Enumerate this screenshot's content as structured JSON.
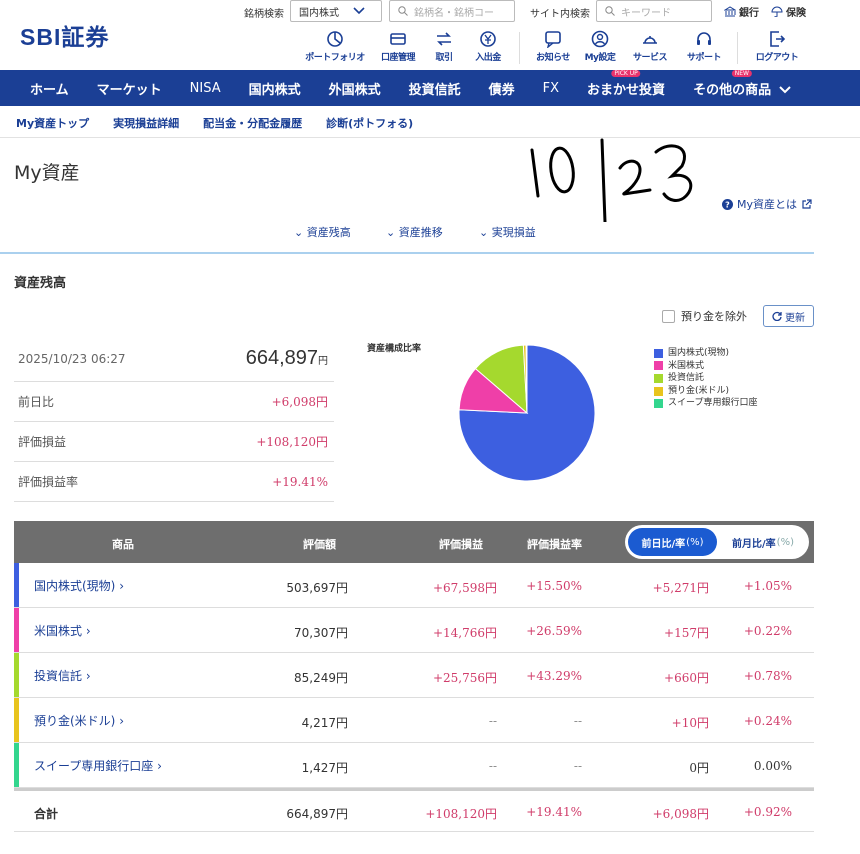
{
  "header": {
    "brand": "SBI証券",
    "search_label": "銘柄検索",
    "market_select": "国内株式",
    "stock_search_placeholder": "銘柄名・銘柄コー",
    "site_search_label": "サイト内検索",
    "keyword_placeholder": "キーワード",
    "bank_link": "銀行",
    "insurance_link": "保険",
    "icons": [
      {
        "label": "ポートフォリオ",
        "icon": "portfolio-icon"
      },
      {
        "label": "口座管理",
        "icon": "account-icon"
      },
      {
        "label": "取引",
        "icon": "trade-icon"
      },
      {
        "label": "入出金",
        "icon": "deposit-icon"
      },
      {
        "label": "お知らせ",
        "icon": "notice-icon"
      },
      {
        "label": "My設定",
        "icon": "user-icon"
      },
      {
        "label": "サービス",
        "icon": "service-icon"
      },
      {
        "label": "サポート",
        "icon": "support-icon"
      },
      {
        "label": "ログアウト",
        "icon": "logout-icon"
      }
    ]
  },
  "nav": {
    "items": [
      "ホーム",
      "マーケット",
      "NISA",
      "国内株式",
      "外国株式",
      "投資信託",
      "債券",
      "FX",
      "おまかせ投資",
      "その他の商品"
    ],
    "badge_pickup": "PICK UP",
    "badge_new": "NEW"
  },
  "subnav": [
    "My資産トップ",
    "実現損益詳細",
    "配当金・分配金履歴",
    "診断(ポトフォる)"
  ],
  "page": {
    "title": "My資産",
    "handwritten_note": "10/23",
    "about_link": "My資産とは",
    "anchors": [
      "資産残高",
      "資産推移",
      "実現損益"
    ],
    "section_title": "資産残高",
    "exclude_cash_label": "預り金を除外",
    "refresh_label": "更新"
  },
  "summary": {
    "datetime": "2025/10/23 06:27",
    "total": "664,897",
    "total_unit": "円",
    "rows": [
      {
        "label": "前日比",
        "value": "+6,098円"
      },
      {
        "label": "評価損益",
        "value": "+108,120円"
      },
      {
        "label": "評価損益率",
        "value": "+19.41%"
      }
    ]
  },
  "chart_data": {
    "type": "pie",
    "title": "資産構成比率",
    "categories": [
      "国内株式(現物)",
      "米国株式",
      "投資信託",
      "預り金(米ドル)",
      "スイープ専用銀行口座"
    ],
    "values": [
      503697,
      70307,
      85249,
      4217,
      1427
    ],
    "colors": [
      "#3d5fe0",
      "#ef3fa8",
      "#a5d92e",
      "#e8c41e",
      "#33d68e"
    ]
  },
  "table": {
    "headers": {
      "product": "商品",
      "valuation": "評価額",
      "pl": "評価損益",
      "pl_rate": "評価損益率"
    },
    "toggle_on": "前日比/率",
    "toggle_on_unit": "(%)",
    "toggle_off": "前月比/率",
    "toggle_off_unit": "(%)",
    "rows": [
      {
        "name": "国内株式(現物)",
        "color": "#3d5fe0",
        "amount": "503,697円",
        "pl": "+67,598円",
        "pl_rate": "+15.50%",
        "day_change": "+5,271円",
        "day_rate": "+1.05%"
      },
      {
        "name": "米国株式",
        "color": "#ef3fa8",
        "amount": "70,307円",
        "pl": "+14,766円",
        "pl_rate": "+26.59%",
        "day_change": "+157円",
        "day_rate": "+0.22%"
      },
      {
        "name": "投資信託",
        "color": "#a5d92e",
        "amount": "85,249円",
        "pl": "+25,756円",
        "pl_rate": "+43.29%",
        "day_change": "+660円",
        "day_rate": "+0.78%"
      },
      {
        "name": "預り金(米ドル)",
        "color": "#e8c41e",
        "amount": "4,217円",
        "pl": "--",
        "pl_rate": "--",
        "day_change": "+10円",
        "day_rate": "+0.24%"
      },
      {
        "name": "スイープ専用銀行口座",
        "color": "#33d68e",
        "amount": "1,427円",
        "pl": "--",
        "pl_rate": "--",
        "day_change": "0円",
        "day_rate": "0.00%"
      }
    ],
    "total": {
      "name": "合計",
      "amount": "664,897円",
      "pl": "+108,120円",
      "pl_rate": "+19.41%",
      "day_change": "+6,098円",
      "day_rate": "+0.92%"
    }
  }
}
